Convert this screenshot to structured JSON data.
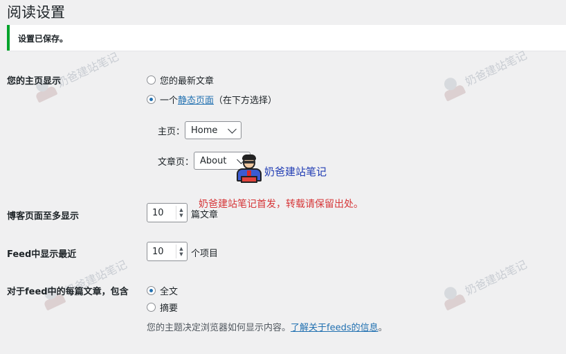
{
  "page": {
    "title": "阅读设置"
  },
  "notice": {
    "text": "设置已保存。"
  },
  "front_page": {
    "label": "您的主页显示",
    "option_latest": "您的最新文章",
    "option_static_prefix": "一个",
    "option_static_link": "静态页面",
    "option_static_suffix": "（在下方选择）",
    "selected": "static",
    "homepage_label": "主页：",
    "homepage_value": "Home",
    "posts_page_label": "文章页：",
    "posts_page_value": "About"
  },
  "posts_per_page": {
    "label": "博客页面至多显示",
    "value": "10",
    "unit": "篇文章"
  },
  "feed_count": {
    "label": "Feed中显示最近",
    "value": "10",
    "unit": "个项目"
  },
  "feed_content": {
    "label": "对于feed中的每篇文章，包含",
    "option_full": "全文",
    "option_summary": "摘要",
    "selected": "full",
    "description": "您的主题决定浏览器如何显示内容。",
    "learn_more": "了解关于feeds的信息",
    "learn_more_suffix": "。"
  },
  "watermark": {
    "text": "奶爸建站笔记",
    "note": "奶爸建站笔记首发，转载请保留出处。"
  },
  "colors": {
    "accent": "#2271b1",
    "success": "#00a32a",
    "error": "#d63638"
  },
  "icons": {
    "watermark_logo": "cartoon-avatar-icon",
    "spinner": "spin-arrows-icon",
    "dropdown": "chevron-down-icon"
  }
}
